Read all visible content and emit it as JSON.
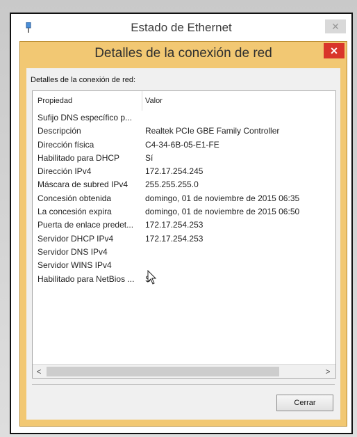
{
  "background_window": {
    "title": "Estado de Ethernet",
    "close_label": "✕"
  },
  "dialog": {
    "title": "Detalles de la conexión de red",
    "close_label": "✕",
    "group_label": "Detalles de la conexión de red:",
    "columns": {
      "property": "Propiedad",
      "value": "Valor"
    },
    "rows": [
      {
        "property": "Sufijo DNS específico p...",
        "value": ""
      },
      {
        "property": "Descripción",
        "value": "Realtek PCIe GBE Family Controller"
      },
      {
        "property": "Dirección física",
        "value": "C4-34-6B-05-E1-FE"
      },
      {
        "property": "Habilitado para DHCP",
        "value": "Sí"
      },
      {
        "property": "Dirección IPv4",
        "value": "172.17.254.245"
      },
      {
        "property": "Máscara de subred IPv4",
        "value": "255.255.255.0"
      },
      {
        "property": "Concesión obtenida",
        "value": "domingo, 01 de noviembre de 2015 06:35"
      },
      {
        "property": "La concesión expira",
        "value": "domingo, 01 de noviembre de 2015 06:50"
      },
      {
        "property": "Puerta de enlace predet...",
        "value": "172.17.254.253"
      },
      {
        "property": "Servidor DHCP IPv4",
        "value": "172.17.254.253"
      },
      {
        "property": "Servidor DNS IPv4",
        "value": ""
      },
      {
        "property": "Servidor WINS IPv4",
        "value": ""
      },
      {
        "property": "Habilitado para NetBios ...",
        "value": "Sí"
      }
    ],
    "scroll_left": "<",
    "scroll_right": ">",
    "close_button_label": "Cerrar"
  },
  "colors": {
    "accent_frame": "#f2c873",
    "close_button": "#d9352a"
  },
  "icons": [
    "network-adapter-icon",
    "close-icon",
    "mouse-cursor-icon"
  ]
}
